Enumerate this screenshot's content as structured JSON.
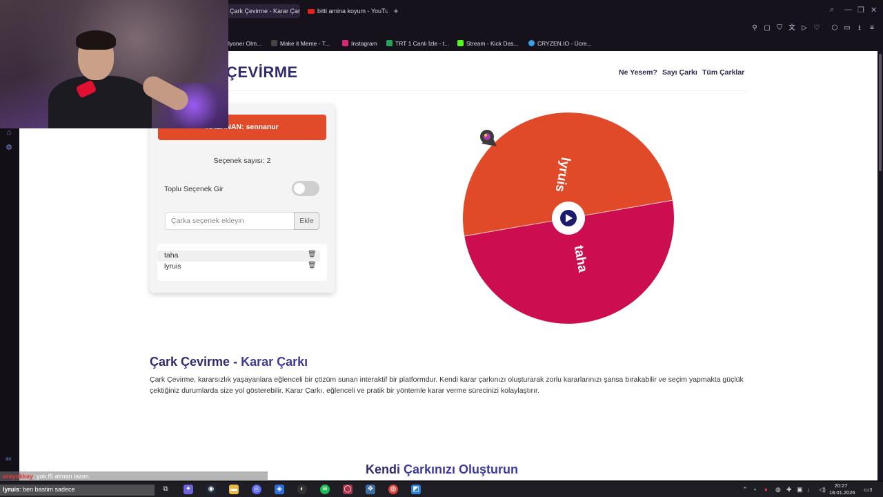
{
  "browser": {
    "tabs": [
      {
        "label": "Çark Çevirme - Karar Çarkı",
        "active": true
      },
      {
        "label": "bitti amina koyum - YouTube",
        "active": false
      }
    ],
    "bookmarks": [
      "lyoner Olm...",
      "Make it Meme - T...",
      "Instagram",
      "TRT 1 Canlı İzle - t...",
      "Stream - Kick Das...",
      "CRYZEN.IO - Ücre..."
    ]
  },
  "site": {
    "logo": "ÇEVİRME",
    "nav": [
      "Ne Yesem?",
      "Sayı Çarkı",
      "Tüm Çarklar"
    ]
  },
  "panel": {
    "winner": "KAZANAN: sennanur",
    "count": "Seçenek sayısı: 2",
    "bulk_label": "Toplu Seçenek Gir",
    "bulk_enabled": false,
    "input_placeholder": "Çarka seçenek ekleyin",
    "add_button": "Ekle",
    "options": [
      "taha",
      "lyruis"
    ]
  },
  "wheel": {
    "segments": [
      {
        "label": "lyruis",
        "color": "#e04a28"
      },
      {
        "label": "taha",
        "color": "#cc0d4f"
      }
    ],
    "center_color": "#1d1b6b"
  },
  "content": {
    "heading_part1": "Çark Çevirme",
    "heading_sep": " - ",
    "heading_part2": "Karar Çarkı",
    "description": "Çark Çevirme, kararsızlık yaşayanlara eğlenceli bir çözüm sunan interaktif bir platformdur. Kendi karar çarkınızı oluşturarak zorlu kararlarınızı şansa bırakabilir ve seçim yapmakta güçlük çektiğiniz durumlarda size yol gösterebilir. Karar Çarkı, eğlenceli ve pratik bir yöntemle karar verme sürecinizi kolaylaştırır.",
    "section_part1": "Kendi",
    "section_part2": "Çarkınızı Oluşturun"
  },
  "overlay": {
    "ax": "ax",
    "chat": [
      {
        "user": "arayokkay",
        "text": ": yok f5 atman lazım"
      },
      {
        "user": "lyruis",
        "text": ": ben bastim sadece"
      }
    ]
  },
  "taskbar": {
    "time": "20:27",
    "date": "18.01.2026",
    "notifications": "3"
  }
}
